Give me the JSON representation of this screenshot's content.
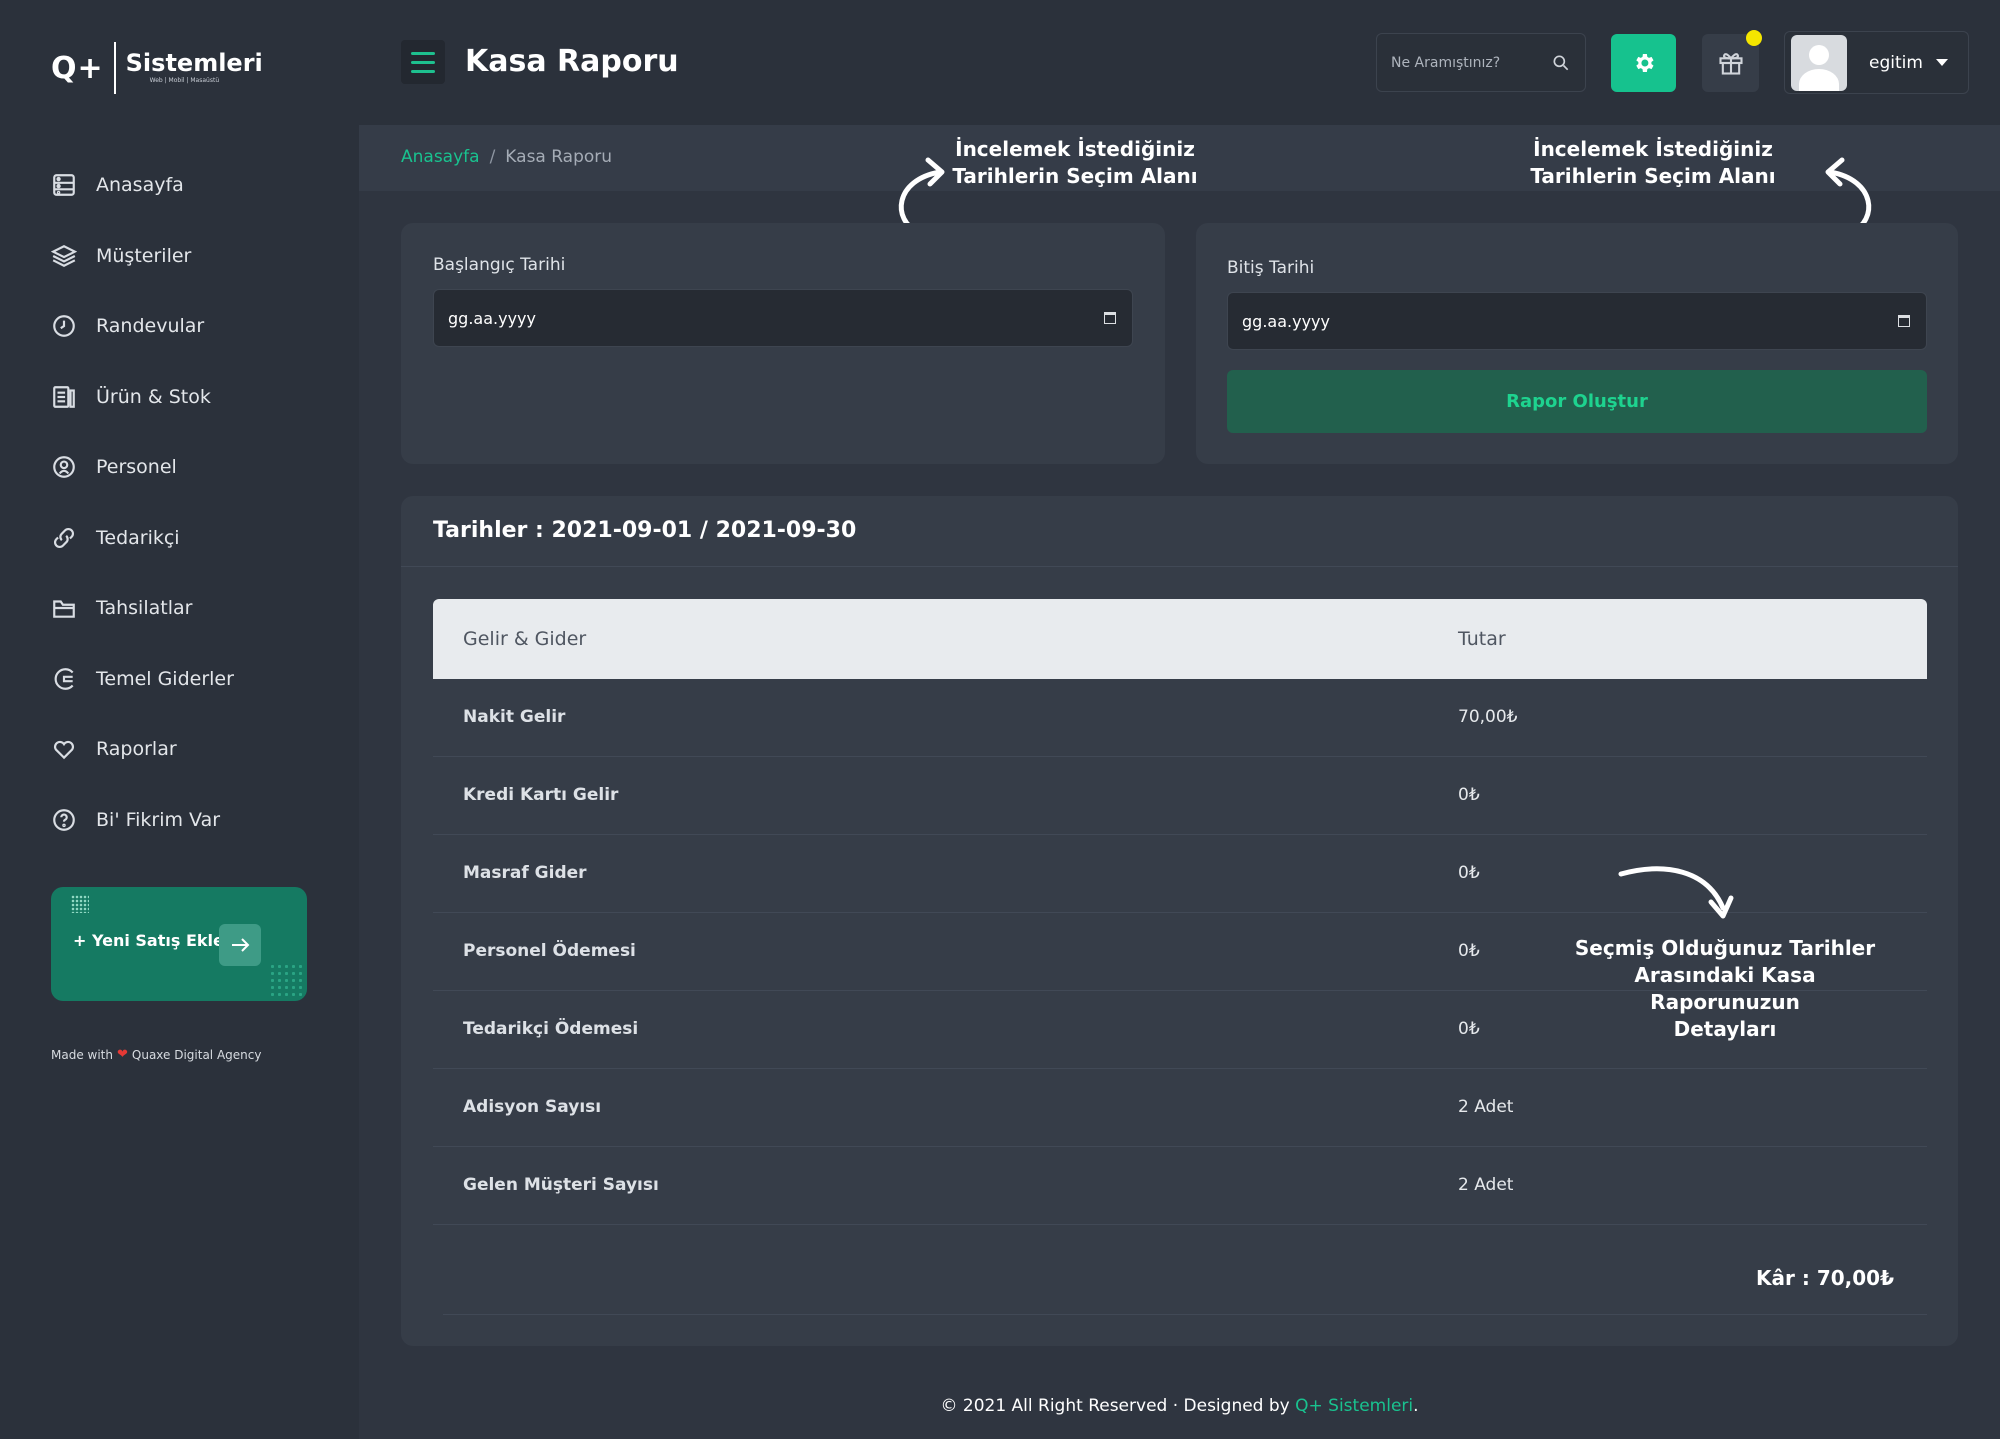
{
  "brand": {
    "mark": "Q+",
    "name": "Sistemleri",
    "tagline": "Web | Mobil | Masaüstü"
  },
  "sidebar": {
    "items": [
      {
        "label": "Anasayfa",
        "icon": "dashboard-icon"
      },
      {
        "label": "Müşteriler",
        "icon": "layers-icon"
      },
      {
        "label": "Randevular",
        "icon": "clock-icon"
      },
      {
        "label": "Ürün & Stok",
        "icon": "inventory-icon"
      },
      {
        "label": "Personel",
        "icon": "person-icon"
      },
      {
        "label": "Tedarikçi",
        "icon": "link-icon"
      },
      {
        "label": "Tahsilatlar",
        "icon": "folder-icon"
      },
      {
        "label": "Temel Giderler",
        "icon": "expense-icon"
      },
      {
        "label": "Raporlar",
        "icon": "heart-icon"
      },
      {
        "label": "Bi' Fikrim Var",
        "icon": "question-icon"
      }
    ],
    "new_sale_label": "+ Yeni Satış Ekle",
    "made_with_prefix": "Made with",
    "made_with_suffix": "Quaxe Digital Agency"
  },
  "header": {
    "title": "Kasa Raporu",
    "search_placeholder": "Ne Aramıştınız?",
    "user_name": "egitim"
  },
  "breadcrumb": {
    "home": "Anasayfa",
    "separator": "/",
    "current": "Kasa Raporu"
  },
  "annotations": {
    "left": "İncelemek İstediğiniz Tarihlerin Seçim Alanı",
    "right": "İncelemek İstediğiniz Tarihlerin Seçim Alanı",
    "detail_line1": "Seçmiş Olduğunuz Tarihler",
    "detail_line2": "Arasındaki Kasa Raporunuzun",
    "detail_line3": "Detayları"
  },
  "filters": {
    "start_label": "Başlangıç Tarihi",
    "start_value": "gg.aa.yyyy",
    "end_label": "Bitiş Tarihi",
    "end_value": "gg.aa.yyyy",
    "submit_label": "Rapor Oluştur"
  },
  "report": {
    "title": "Tarihler : 2021-09-01 / 2021-09-30",
    "columns": [
      "Gelir & Gider",
      "Tutar"
    ],
    "rows": [
      {
        "label": "Nakit Gelir",
        "value": "70,00₺"
      },
      {
        "label": "Kredi Kartı Gelir",
        "value": "0₺"
      },
      {
        "label": "Masraf Gider",
        "value": "0₺"
      },
      {
        "label": "Personel Ödemesi",
        "value": "0₺"
      },
      {
        "label": "Tedarikçi Ödemesi",
        "value": "0₺"
      },
      {
        "label": "Adisyon Sayısı",
        "value": "2 Adet"
      },
      {
        "label": "Gelen Müşteri Sayısı",
        "value": "2 Adet"
      }
    ],
    "profit": "Kâr : 70,00₺"
  },
  "footer": {
    "text": "© 2021 All Right Reserved · Designed by",
    "link": "Q+ Sistemleri",
    "end": "."
  },
  "colors": {
    "accent": "#16c28e",
    "background": "#2f3540",
    "sidebar": "#2b313b",
    "card": "#363d48",
    "notification": "#f5e600"
  }
}
